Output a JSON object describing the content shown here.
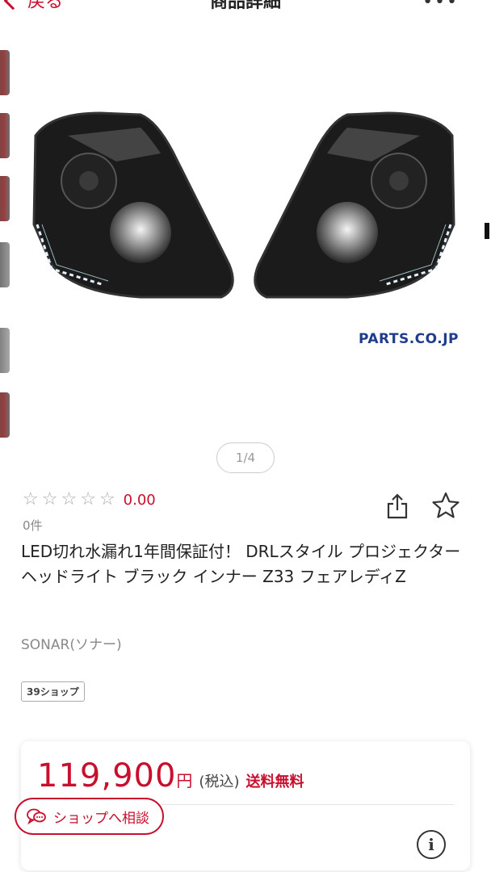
{
  "header": {
    "back_label": "戻る",
    "title": "商品詳細",
    "more_icon": "more-icon"
  },
  "gallery": {
    "watermark": "PARTS.CO.JP",
    "pager": "1/4"
  },
  "rating": {
    "stars": 0,
    "value": "0.00",
    "count": "0件"
  },
  "product": {
    "title": "LED切れ水漏れ1年間保証付！ DRLスタイル プロジェクター ヘッドライト ブラック インナー Z33 フェアレディZ",
    "brand": "SONAR(ソナー)",
    "shop_badge": "39ショップ"
  },
  "price": {
    "amount": "119,900",
    "yen": "円",
    "tax": "(税込)",
    "shipping": "送料無料"
  },
  "consult_button": {
    "label": "ショップへ相談"
  },
  "colors": {
    "accent": "#c8102e",
    "watermark": "#1f3d8c"
  }
}
